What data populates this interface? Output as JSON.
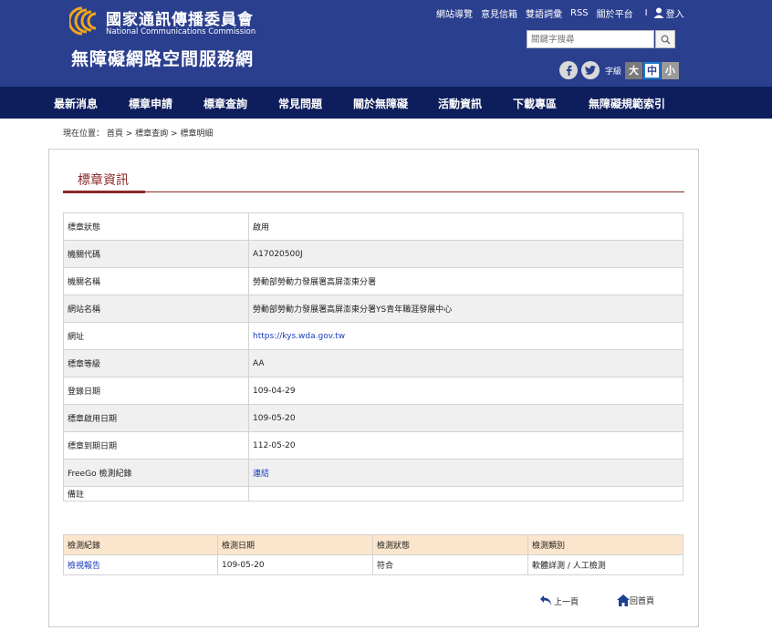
{
  "header": {
    "org_cn": "國家通訊傳播委員會",
    "org_en": "National Communications Commission",
    "site_title": "無障礙網路空間服務網",
    "links": [
      "網站導覽",
      "意見信箱",
      "雙語詞彙",
      "RSS",
      "關於平台"
    ],
    "separator": "I",
    "login_label": "登入",
    "search_placeholder": "關鍵字搜尋",
    "fontsize_label": "字級",
    "fontsize_large": "大",
    "fontsize_medium": "中",
    "fontsize_small": "小"
  },
  "nav": [
    "最新消息",
    "標章申請",
    "標章查詢",
    "常見問題",
    "關於無障礙",
    "活動資訊",
    "下載專區",
    "無障礙規範索引"
  ],
  "breadcrumb": "現在位置： 首頁 > 標章查詢 > 標章明細",
  "section_title": "標章資訊",
  "info": {
    "status_label": "標章狀態",
    "status_value": "啟用",
    "agency_code_label": "機關代碼",
    "agency_code_value": "A17020500J",
    "agency_name_label": "機關名稱",
    "agency_name_value": "勞動部勞動力發展署高屏澎東分署",
    "site_name_label": "網站名稱",
    "site_name_value": "勞動部勞動力發展署高屏澎東分署YS青年職涯發展中心",
    "url_label": "網址",
    "url_value": "https://kys.wda.gov.tw",
    "level_label": "標章等級",
    "level_value": "AA",
    "reg_date_label": "登錄日期",
    "reg_date_value": "109-04-29",
    "start_date_label": "標章啟用日期",
    "start_date_value": "109-05-20",
    "expire_date_label": "標章到期日期",
    "expire_date_value": "112-05-20",
    "freego_label": "FreeGo 檢測紀錄",
    "freego_value": "連結",
    "remark_label": "備註",
    "remark_value": ""
  },
  "records": {
    "headers": [
      "檢測紀錄",
      "檢測日期",
      "檢測狀態",
      "檢測類別"
    ],
    "row": {
      "record": "檢視報告",
      "date": "109-05-20",
      "status": "符合",
      "type": "軟體詳測 / 人工檢測"
    }
  },
  "pager": {
    "prev": "上一頁",
    "home": "回首頁"
  }
}
